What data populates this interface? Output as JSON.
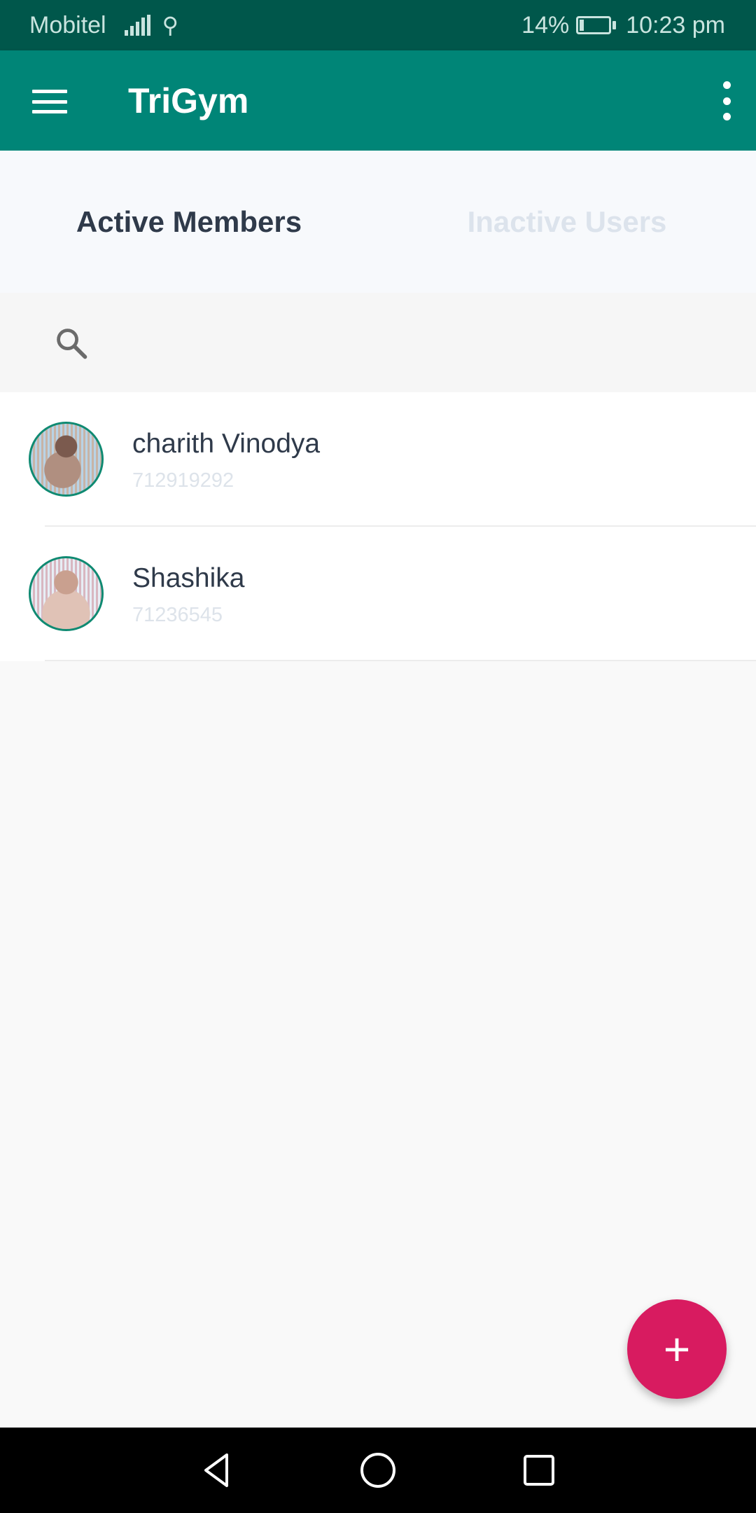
{
  "status_bar": {
    "carrier": "Mobitel",
    "battery_percent": "14%",
    "battery_level": 0.14,
    "time": "10:23 pm",
    "icons": [
      "signal-icon",
      "usb-icon",
      "battery-charging-icon"
    ]
  },
  "app_bar": {
    "title": "TriGym",
    "icons": [
      "menu-icon",
      "more-vert-icon"
    ]
  },
  "tabs": [
    {
      "label": "Active Members",
      "active": true
    },
    {
      "label": "Inactive Users",
      "active": false
    }
  ],
  "search": {
    "icon": "search-icon",
    "value": "",
    "placeholder": ""
  },
  "members": [
    {
      "name": "charith Vinodya",
      "phone": "712919292"
    },
    {
      "name": "Shashika",
      "phone": "71236545"
    }
  ],
  "fab": {
    "icon": "plus-icon",
    "symbol": "+"
  },
  "nav_bar": {
    "icons": [
      "back-icon",
      "home-icon",
      "recents-icon"
    ]
  },
  "colors": {
    "primary": "#008577",
    "primary_dark": "#00574b",
    "accent": "#d81b60",
    "text_dark": "#2f3a4a",
    "text_muted": "#dde3ea"
  }
}
